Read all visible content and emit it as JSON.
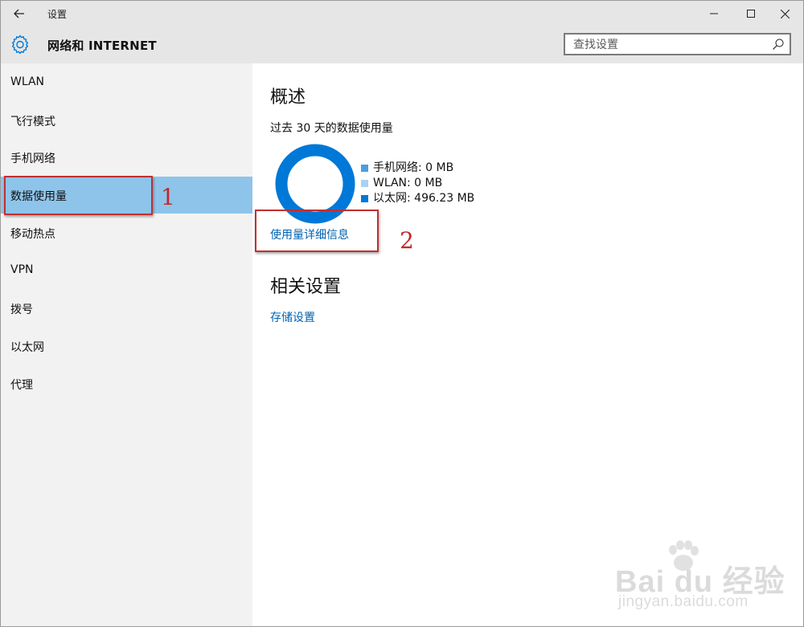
{
  "window": {
    "title": "设置",
    "controls": [
      "minimize",
      "maximize",
      "close"
    ]
  },
  "header": {
    "title": "网络和 INTERNET",
    "search_placeholder": "查找设置"
  },
  "sidebar": {
    "items": [
      {
        "label": "WLAN"
      },
      {
        "label": "飞行模式"
      },
      {
        "label": "手机网络"
      },
      {
        "label": "数据使用量",
        "selected": true
      },
      {
        "label": "移动热点"
      },
      {
        "label": "VPN"
      },
      {
        "label": "拨号"
      },
      {
        "label": "以太网"
      },
      {
        "label": "代理"
      }
    ]
  },
  "main": {
    "overview_title": "概述",
    "usage_subtitle": "过去 30 天的数据使用量",
    "legend": [
      {
        "label": "手机网络: 0 MB",
        "color": "#4e9de0"
      },
      {
        "label": "WLAN: 0 MB",
        "color": "#a9d1f3"
      },
      {
        "label": "以太网: 496.23 MB",
        "color": "#0078d7"
      }
    ],
    "donut_color": "#0078d7",
    "details_link": "使用量详细信息",
    "related_title": "相关设置",
    "storage_link": "存储设置"
  },
  "annotations": {
    "step1": "1",
    "step2": "2"
  },
  "watermark": {
    "brand": "Bai du 经验",
    "url": "jingyan.baidu.com"
  }
}
